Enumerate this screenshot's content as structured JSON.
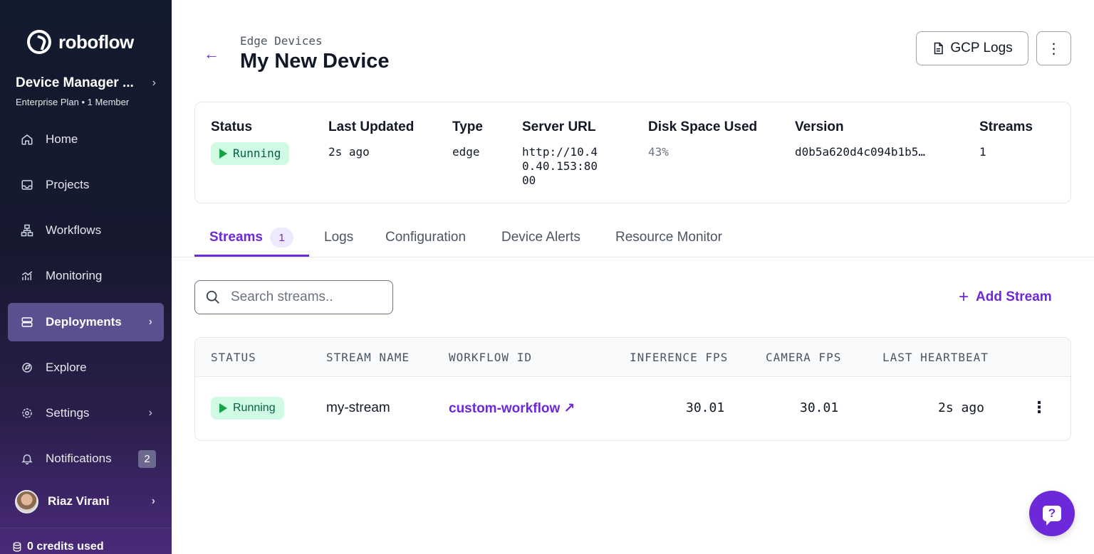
{
  "sidebar": {
    "logo_text": "roboflow",
    "workspace_name": "Device Manager ...",
    "workspace_plan": "Enterprise Plan",
    "workspace_members": "1 Member",
    "items": [
      {
        "label": "Home",
        "icon": "home-icon"
      },
      {
        "label": "Projects",
        "icon": "inbox-icon"
      },
      {
        "label": "Workflows",
        "icon": "workflow-icon"
      },
      {
        "label": "Monitoring",
        "icon": "chart-icon"
      },
      {
        "label": "Deployments",
        "icon": "server-icon"
      },
      {
        "label": "Explore",
        "icon": "compass-icon"
      },
      {
        "label": "Settings",
        "icon": "gear-icon"
      },
      {
        "label": "Notifications",
        "icon": "bell-icon"
      }
    ],
    "notifications_count": "2",
    "user_name": "Riaz Virani",
    "credits": "0 credits used"
  },
  "header": {
    "breadcrumb": "Edge Devices",
    "title": "My New Device",
    "gcp_logs_label": "GCP Logs"
  },
  "device": {
    "labels": {
      "status": "Status",
      "last_updated": "Last Updated",
      "type": "Type",
      "server_url": "Server URL",
      "disk_space": "Disk Space Used",
      "version": "Version",
      "streams": "Streams"
    },
    "status": "Running",
    "last_updated": "2s ago",
    "type": "edge",
    "server_url_lines": [
      "http://10.4",
      "0.40.153:80",
      "00"
    ],
    "disk_space": "43%",
    "version": "d0b5a620d4c094b1b5…",
    "streams": "1"
  },
  "tabs": [
    {
      "label": "Streams",
      "count": "1"
    },
    {
      "label": "Logs"
    },
    {
      "label": "Configuration"
    },
    {
      "label": "Device Alerts"
    },
    {
      "label": "Resource Monitor"
    }
  ],
  "search": {
    "placeholder": "Search streams.."
  },
  "add_stream_label": "Add Stream",
  "table": {
    "headers": [
      "STATUS",
      "STREAM NAME",
      "WORKFLOW ID",
      "INFERENCE FPS",
      "CAMERA FPS",
      "LAST HEARTBEAT"
    ],
    "rows": [
      {
        "status": "Running",
        "stream_name": "my-stream",
        "workflow_id": "custom-workflow",
        "inference_fps": "30.01",
        "camera_fps": "30.01",
        "last_heartbeat": "2s ago"
      }
    ]
  },
  "colors": {
    "accent": "#6d28d9",
    "running_bg": "#d1fae5",
    "running_icon": "#16a34a"
  }
}
